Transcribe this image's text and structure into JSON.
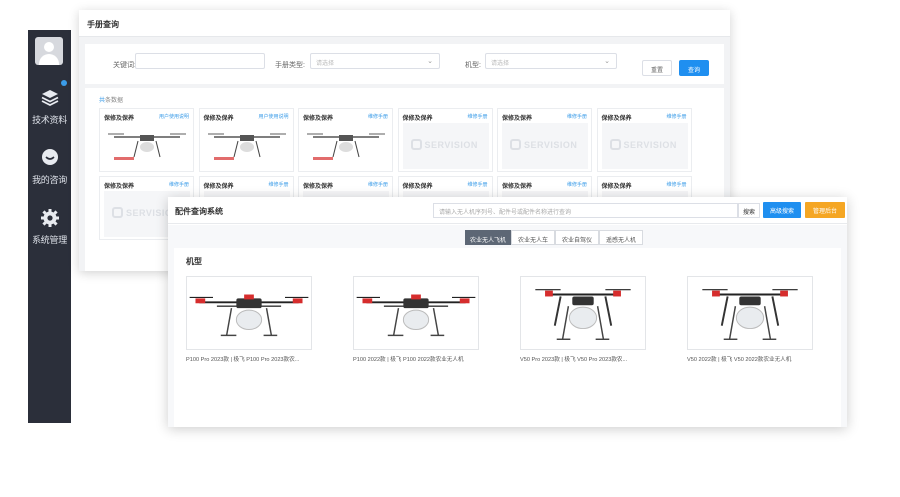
{
  "sidebar": {
    "items": [
      {
        "label": "技术资料",
        "icon": "layers-icon"
      },
      {
        "label": "我的咨询",
        "icon": "chat-icon"
      },
      {
        "label": "系统管理",
        "icon": "gear-icon"
      }
    ]
  },
  "manual": {
    "title": "手册查询",
    "filters": {
      "keyword_label": "关键词:",
      "keyword_placeholder": "",
      "category_label": "手册类型:",
      "category_placeholder": "请选择",
      "model_label": "机型:",
      "model_placeholder": "请选择"
    },
    "reset_label": "重置",
    "query_label": "查询",
    "grid_label_prefix": "共",
    "grid_label_suffix": "条数据",
    "cards": [
      {
        "title": "保修及保养",
        "tag": "用户使用说明",
        "img": "drone"
      },
      {
        "title": "保修及保养",
        "tag": "用户使用说明",
        "img": "drone"
      },
      {
        "title": "保修及保养",
        "tag": "维修手册",
        "img": "drone"
      },
      {
        "title": "保修及保养",
        "tag": "维修手册",
        "img": "logo"
      },
      {
        "title": "保修及保养",
        "tag": "维修手册",
        "img": "logo"
      },
      {
        "title": "保修及保养",
        "tag": "维修手册",
        "img": "logo"
      },
      {
        "title": "保修及保养",
        "tag": "维修手册",
        "img": "logo"
      },
      {
        "title": "保修及保养",
        "tag": "维修手册",
        "img": "logo"
      },
      {
        "title": "保修及保养",
        "tag": "维修手册",
        "img": "logo"
      },
      {
        "title": "保修及保养",
        "tag": "维修手册",
        "img": "logo"
      },
      {
        "title": "保修及保养",
        "tag": "维修手册",
        "img": "logo"
      },
      {
        "title": "保修及保养",
        "tag": "维修手册",
        "img": "logo"
      }
    ],
    "logo_text": "SERVISION"
  },
  "parts": {
    "title": "配件查询系统",
    "search_placeholder": "请输入无人机序列号、配件号或配件名称进行查询",
    "search_button": "搜索",
    "advanced_button": "高级搜索",
    "manage_button": "管理后台",
    "tabs": [
      "农业无人飞机",
      "农业无人车",
      "农业自驾仪",
      "遥感无人机"
    ],
    "active_tab": 0,
    "section_title": "机型",
    "products": [
      {
        "name": "P100 Pro 2023款 | 极飞 P100 Pro 2023款农..."
      },
      {
        "name": "P100 2022款 | 极飞 P100 2022款农业无人机"
      },
      {
        "name": "V50 Pro 2023款 | 极飞 V50 Pro 2023款农..."
      },
      {
        "name": "V50 2022款 | 极飞 V50 2022款农业无人机"
      }
    ]
  },
  "colors": {
    "sidebar_bg": "#2b2f3a",
    "primary": "#1f8ff0",
    "warning": "#f5a623",
    "drone_accent": "#d62d2d"
  }
}
